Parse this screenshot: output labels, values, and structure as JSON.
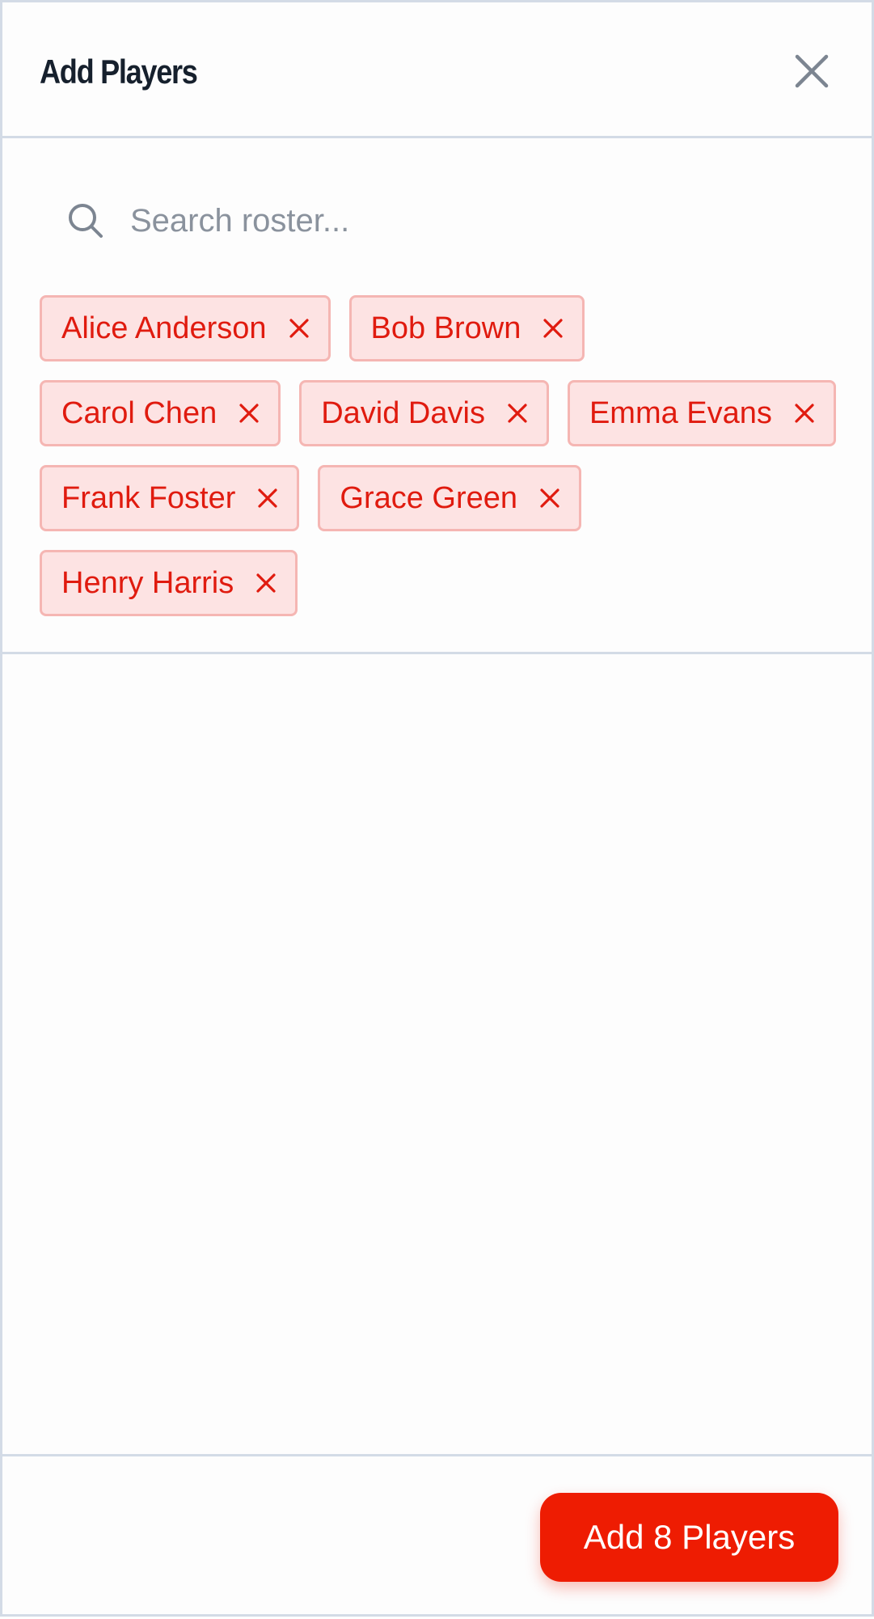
{
  "header": {
    "title": "Add Players",
    "close_icon": "close-icon"
  },
  "search": {
    "icon": "search-icon",
    "placeholder": "Search roster...",
    "value": ""
  },
  "selected_players": [
    {
      "label": "Alice Anderson"
    },
    {
      "label": "Bob Brown"
    },
    {
      "label": "Carol Chen"
    },
    {
      "label": "David Davis"
    },
    {
      "label": "Emma Evans"
    },
    {
      "label": "Frank Foster"
    },
    {
      "label": "Grace Green"
    },
    {
      "label": "Henry Harris"
    }
  ],
  "footer": {
    "submit_label": "Add 8 Players"
  },
  "colors": {
    "accent": "#ee1c02",
    "chip_bg": "#fde3e3",
    "chip_border": "#f5b6b3",
    "chip_text": "#e01b0f",
    "divider": "#d3dbe6",
    "title_text": "#16202d",
    "icon_gray": "#7c8591"
  }
}
